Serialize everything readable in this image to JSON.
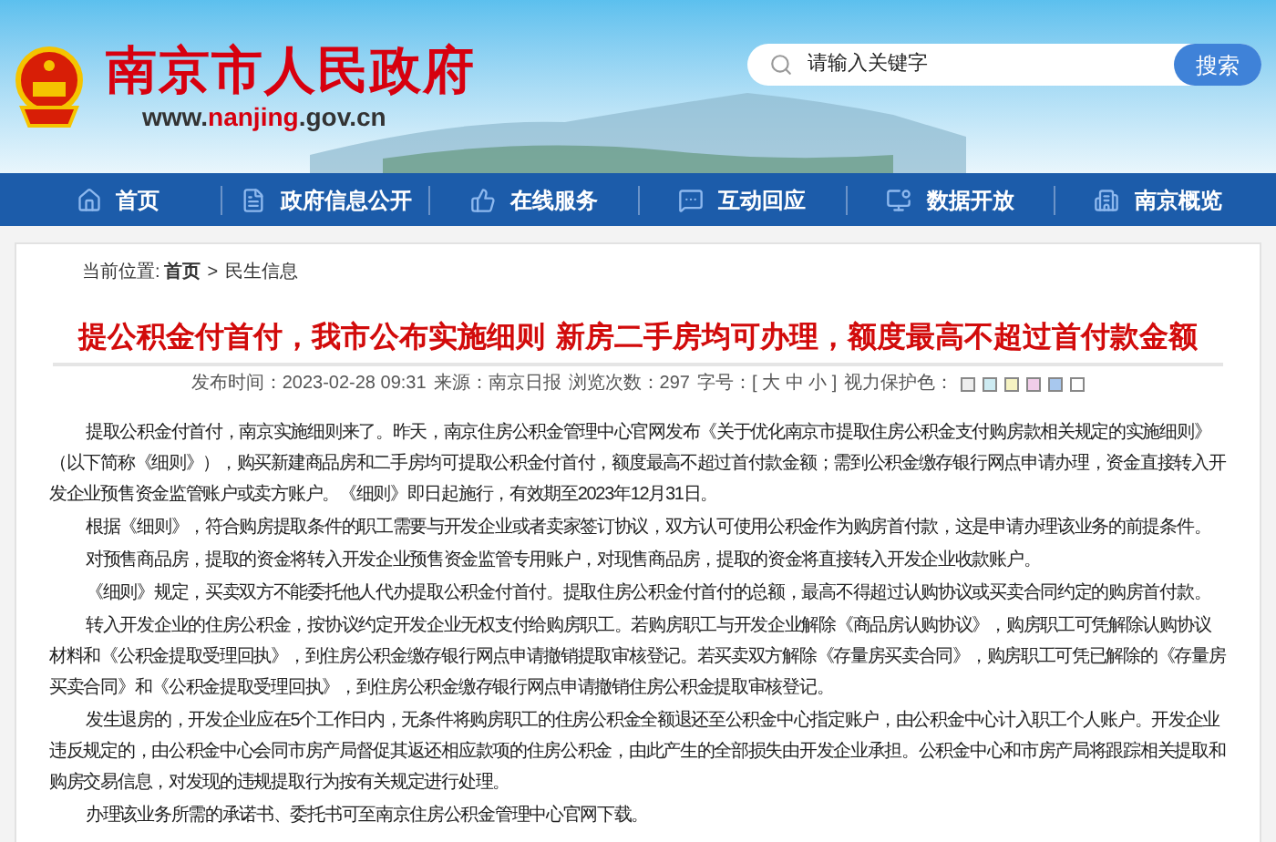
{
  "site": {
    "name": "南京市人民政府",
    "url": {
      "prefix": "www.",
      "highlight": "nanjing",
      "suffix": ".gov.cn"
    }
  },
  "search": {
    "placeholder": "请输入关键字",
    "button": "搜索"
  },
  "nav": [
    {
      "label": "首页"
    },
    {
      "label": "政府信息公开"
    },
    {
      "label": "在线服务"
    },
    {
      "label": "互动回应"
    },
    {
      "label": "数据开放"
    },
    {
      "label": "南京概览"
    }
  ],
  "breadcrumb": {
    "label": "当前位置:",
    "items": [
      "首页",
      "民生信息"
    ],
    "separator": ">"
  },
  "article": {
    "title": "提公积金付首付，我市公布实施细则 新房二手房均可办理，额度最高不超过首付款金额",
    "meta": [
      "发布时间：2023-02-28 09:31",
      "来源：南京日报",
      "浏览次数：297",
      "字号：[ 大 中 小 ]",
      "视力保护色："
    ],
    "swatches": [
      {
        "color": "#eeeeee"
      },
      {
        "color": "#cdebf2"
      },
      {
        "color": "#f6f3c2"
      },
      {
        "color": "#f1cde9"
      },
      {
        "color": "#a8c8ee"
      },
      {
        "color": "#ffffff"
      }
    ],
    "paragraphs": [
      "提取公积金付首付，南京实施细则来了。昨天，南京住房公积金管理中心官网发布《关于优化南京市提取住房公积金支付购房款相关规定的实施细则》（以下简称《细则》），购买新建商品房和二手房均可提取公积金付首付，额度最高不超过首付款金额；需到公积金缴存银行网点申请办理，资金直接转入开发企业预售资金监管账户或卖方账户。《细则》即日起施行，有效期至2023年12月31日。",
      "根据《细则》，符合购房提取条件的职工需要与开发企业或者卖家签订协议，双方认可使用公积金作为购房首付款，这是申请办理该业务的前提条件。",
      "对预售商品房，提取的资金将转入开发企业预售资金监管专用账户，对现售商品房，提取的资金将直接转入开发企业收款账户。",
      "《细则》规定，买卖双方不能委托他人代办提取公积金付首付。提取住房公积金付首付的总额，最高不得超过认购协议或买卖合同约定的购房首付款。",
      "转入开发企业的住房公积金，按协议约定开发企业无权支付给购房职工。若购房职工与开发企业解除《商品房认购协议》，购房职工可凭解除认购协议材料和《公积金提取受理回执》，到住房公积金缴存银行网点申请撤销提取审核登记。若买卖双方解除《存量房买卖合同》，购房职工可凭已解除的《存量房买卖合同》和《公积金提取受理回执》，到住房公积金缴存银行网点申请撤销住房公积金提取审核登记。",
      "发生退房的，开发企业应在5个工作日内，无条件将购房职工的住房公积金全额退还至公积金中心指定账户，由公积金中心计入职工个人账户。开发企业违反规定的，由公积金中心会同市房产局督促其返还相应款项的住房公积金，由此产生的全部损失由开发企业承担。公积金中心和市房产局将跟踪相关提取和购房交易信息，对发现的违规提取行为按有关规定进行处理。",
      "办理该业务所需的承诺书、委托书可至南京住房公积金管理中心官网下载。"
    ]
  }
}
